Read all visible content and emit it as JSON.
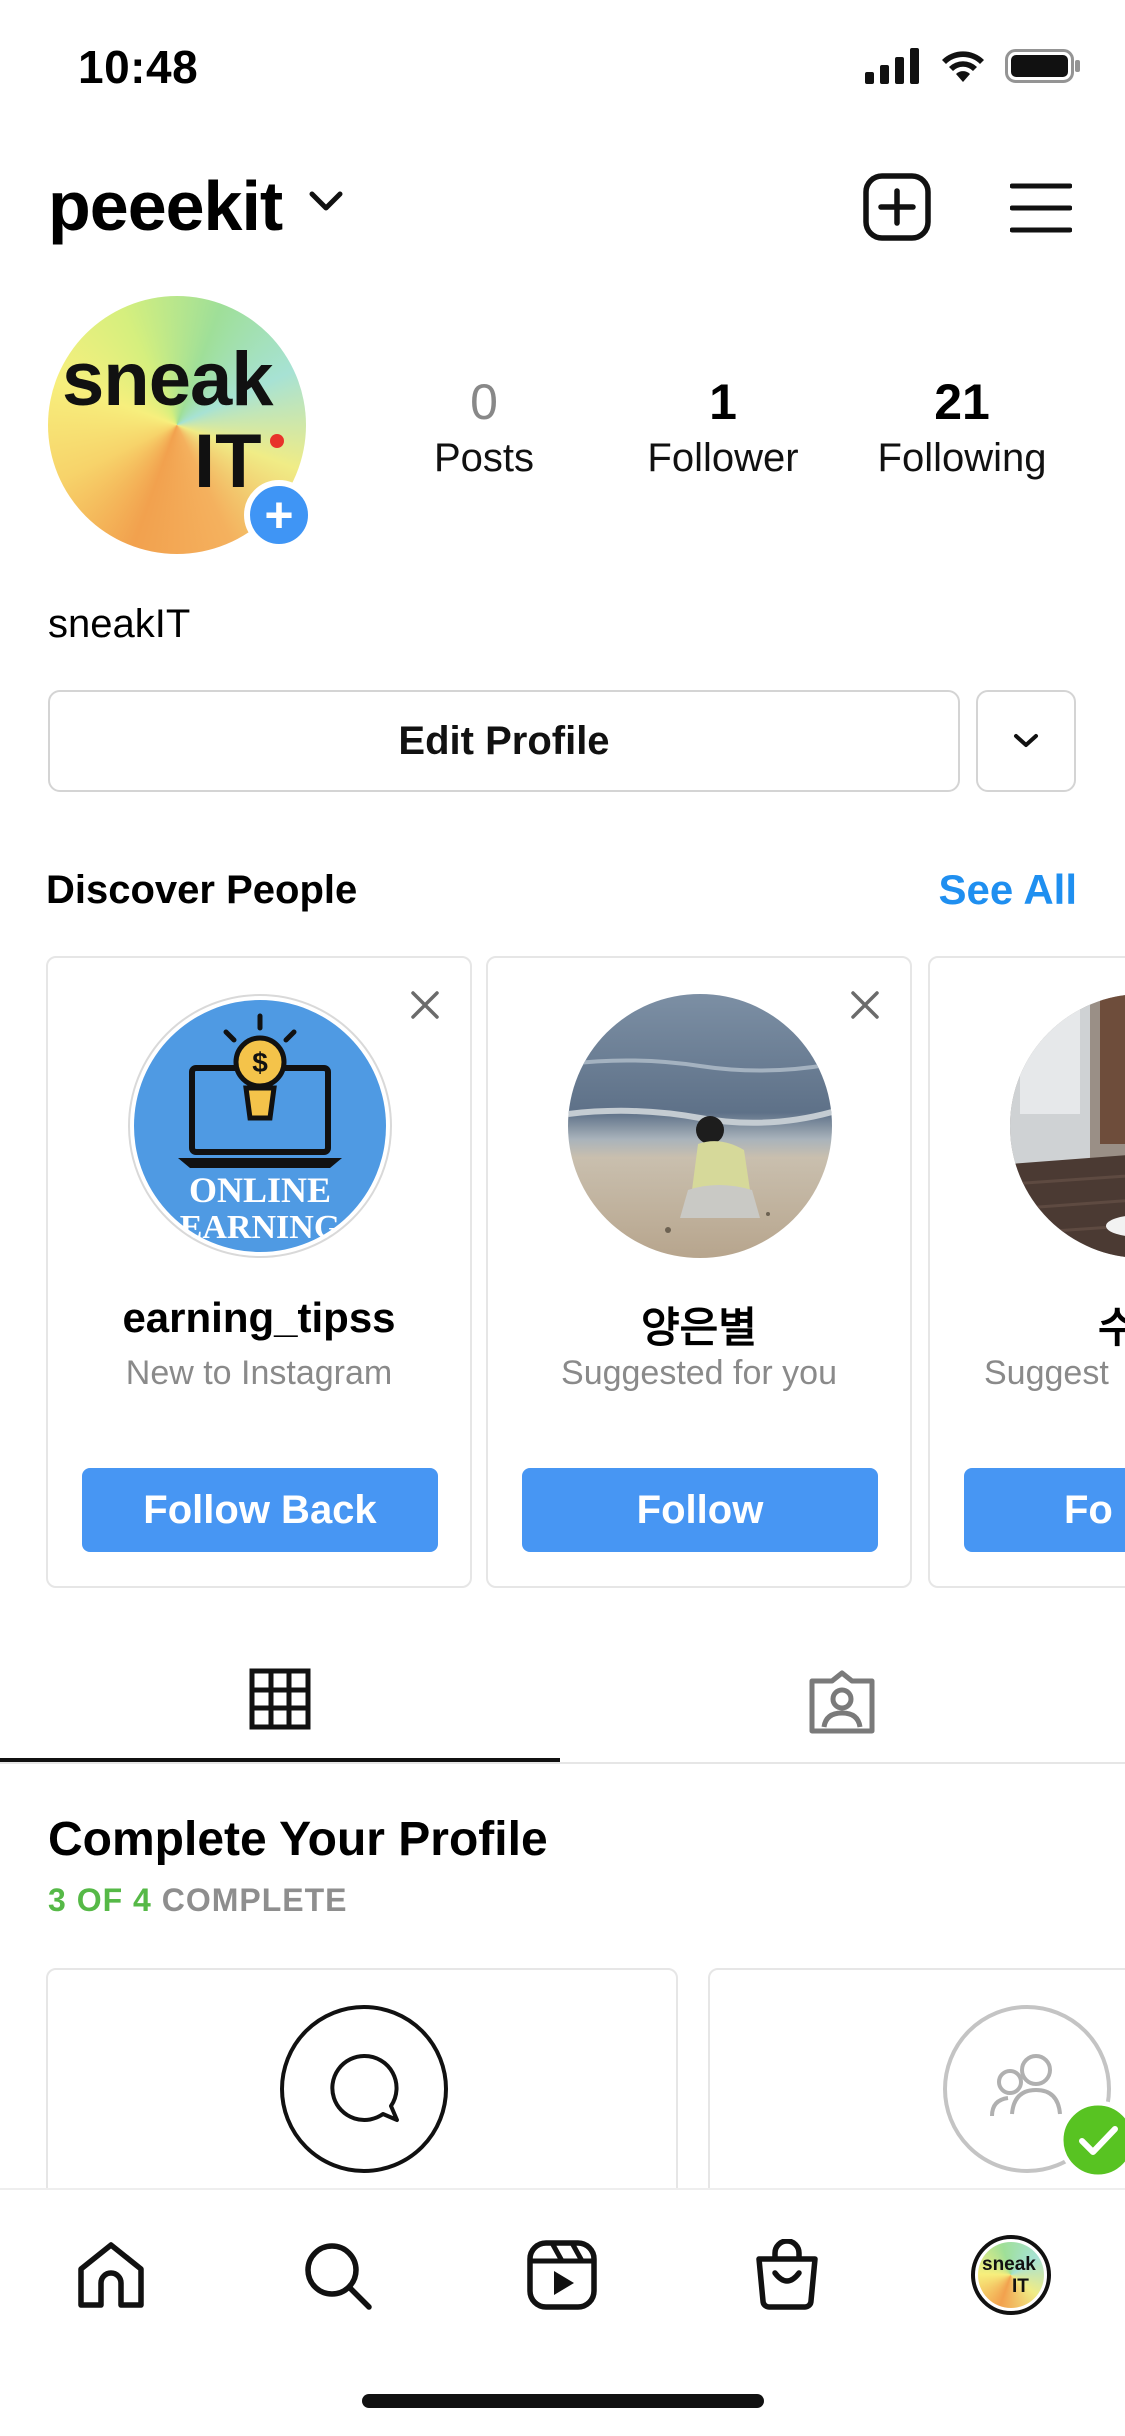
{
  "status_bar": {
    "time": "10:48"
  },
  "header": {
    "username": "peeekit"
  },
  "profile": {
    "avatar_text_line1": "sneak",
    "avatar_text_line2": "IT",
    "display_name": "sneakIT",
    "stats": [
      {
        "value": "0",
        "label": "Posts"
      },
      {
        "value": "1",
        "label": "Follower"
      },
      {
        "value": "21",
        "label": "Following"
      }
    ],
    "edit_profile_label": "Edit Profile"
  },
  "discover": {
    "title": "Discover People",
    "see_all_label": "See All",
    "cards": [
      {
        "name": "earning_tipss",
        "subtitle": "New to Instagram",
        "button": "Follow Back",
        "avatar_text1": "ONLINE",
        "avatar_text2": "EARNING"
      },
      {
        "name": "양은별",
        "subtitle": "Suggested for you",
        "button": "Follow"
      },
      {
        "name": "수",
        "subtitle": "Suggest",
        "button": "Fo"
      }
    ]
  },
  "complete_profile": {
    "title": "Complete Your Profile",
    "progress_done": "3 OF 4",
    "progress_rest": "COMPLETE"
  },
  "bottom_nav": {
    "avatar_line1": "sneak",
    "avatar_line2": "IT"
  },
  "colors": {
    "accent_blue": "#1f8ff0",
    "button_blue": "#4796f3",
    "progress_green": "#56b947",
    "check_green": "#58c322"
  },
  "icons": [
    "signal-icon",
    "wifi-icon",
    "battery-icon",
    "chevron-down-icon",
    "new-post-icon",
    "menu-icon",
    "close-icon",
    "grid-icon",
    "tagged-icon",
    "comment-icon",
    "people-icon",
    "checkmark-icon",
    "home-icon",
    "search-icon",
    "reels-icon",
    "shop-icon"
  ]
}
